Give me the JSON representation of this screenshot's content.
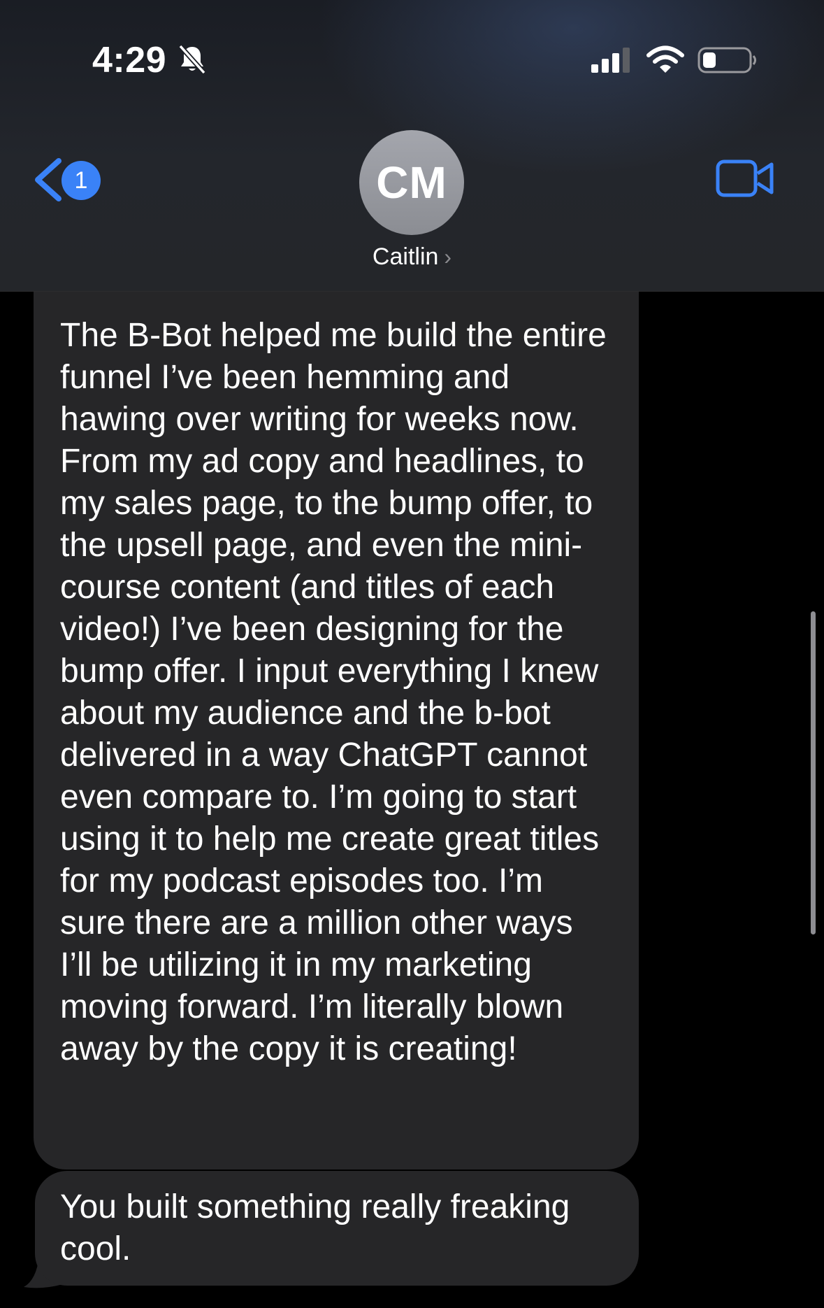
{
  "status_bar": {
    "time": "4:29",
    "silent_icon": "bell-slash-icon",
    "signal_icon": "cellular-signal-icon",
    "wifi_icon": "wifi-icon",
    "battery_icon": "battery-low-icon"
  },
  "nav": {
    "back_icon": "chevron-left-icon",
    "unread_count": "1",
    "video_icon": "video-camera-icon",
    "accent_color": "#3a82f7"
  },
  "contact": {
    "initials": "CM",
    "name": "Caitlin",
    "chevron": "›"
  },
  "messages": [
    {
      "direction": "received",
      "text": "The B-Bot helped me build the entire funnel I’ve been hemming and hawing over writing for weeks now. From my ad copy and headlines, to my sales page, to the bump offer, to the upsell page, and even the mini-course content (and titles of each video!) I’ve been designing for the bump offer. I input everything I knew about my audience and the b-bot delivered in a way ChatGPT cannot even compare to. I’m going to start using it to help me create great titles for my podcast episodes too. I’m sure there are a million other ways I’ll be utilizing it in my marketing moving forward. I’m literally blown away by the copy it is creating!"
    },
    {
      "direction": "received",
      "text": "You built something really freaking cool."
    }
  ]
}
